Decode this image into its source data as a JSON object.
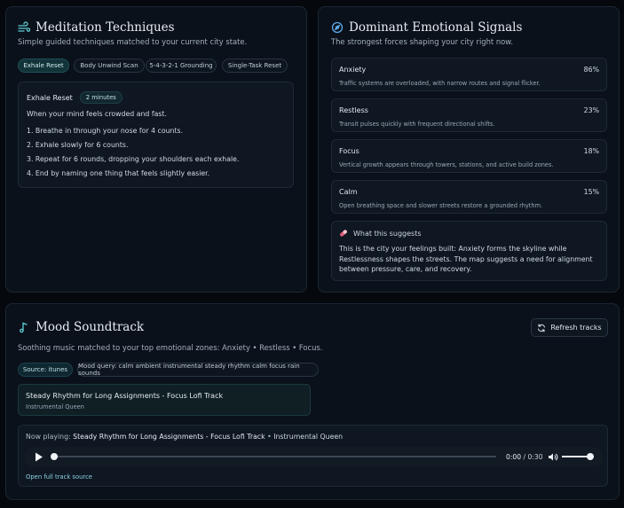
{
  "meditation": {
    "title": "Meditation Techniques",
    "subtitle": "Simple guided techniques matched to your current city state.",
    "tabs": [
      {
        "label": "Exhale Reset",
        "active": true
      },
      {
        "label": "Body Unwind Scan",
        "active": false
      },
      {
        "label": "5-4-3-2-1 Grounding",
        "active": false
      },
      {
        "label": "Single-Task Reset",
        "active": false
      }
    ],
    "card": {
      "name": "Exhale Reset",
      "duration": "2 minutes",
      "intro": "When your mind feels crowded and fast.",
      "steps": [
        "1. Breathe in through your nose for 4 counts.",
        "2. Exhale slowly for 6 counts.",
        "3. Repeat for 6 rounds, dropping your shoulders each exhale.",
        "4. End by naming one thing that feels slightly easier."
      ]
    }
  },
  "signals": {
    "title": "Dominant Emotional Signals",
    "subtitle": "The strongest forces shaping your city right now.",
    "items": [
      {
        "name": "Anxiety",
        "pct": "86%",
        "desc": "Traffic systems are overloaded, with narrow routes and signal flicker."
      },
      {
        "name": "Restless",
        "pct": "23%",
        "desc": "Transit pulses quickly with frequent directional shifts."
      },
      {
        "name": "Focus",
        "pct": "18%",
        "desc": "Vertical growth appears through towers, stations, and active build zones."
      },
      {
        "name": "Calm",
        "pct": "15%",
        "desc": "Open breathing space and slower streets restore a grounded rhythm."
      }
    ],
    "suggest_title": "What this suggests",
    "suggest_text": "This is the city your feelings built: Anxiety forms the skyline while Restlessness shapes the streets. The map suggests a need for alignment between pressure, care, and recovery."
  },
  "soundtrack": {
    "title": "Mood Soundtrack",
    "refresh_label": "Refresh tracks",
    "subtitle": "Soothing music matched to your top emotional zones: Anxiety • Restless • Focus.",
    "source_chip": "Source: itunes",
    "query_chip": "Mood query: calm ambient instrumental steady rhythm calm focus rain sounds",
    "track_title": "Steady Rhythm for Long Assignments - Focus Lofi Track",
    "track_artist": "Instrumental Queen",
    "now_playing_label": "Now playing:",
    "now_playing_title": "Steady Rhythm for Long Assignments - Focus Lofi Track",
    "now_playing_sep": "•",
    "now_playing_artist": "Instrumental Queen",
    "time_current": "0:00",
    "time_sep": "/",
    "time_total": "0:30",
    "progress": 0.0,
    "volume": 1.0,
    "source_link": "Open full track source"
  },
  "colors": {
    "accent": "#5fd0d6",
    "background": "#05080d",
    "panel": "#0a111a"
  }
}
